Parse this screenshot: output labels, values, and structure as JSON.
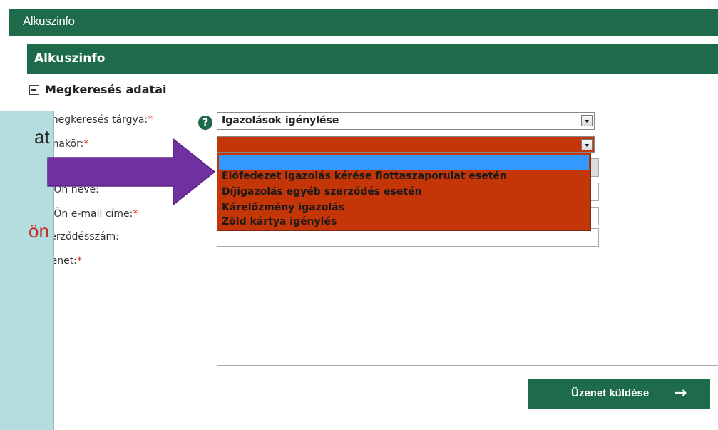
{
  "window": {
    "title": "Alkuszinfo"
  },
  "panel": {
    "title": "Alkuszinfo"
  },
  "section": {
    "title": "Megkeresés adatai"
  },
  "form": {
    "subject_label": "A megkeresés tárgya:",
    "subject_value": "Igazolások igénylése",
    "topic_label": "Témakör:",
    "name_label": "Az Ön neve:",
    "email_label": "Az Ön e-mail címe:",
    "contract_label": "Szerződésszám:",
    "message_label": "Üzenet:",
    "required_mark": "*",
    "help_icon": "?"
  },
  "dropdown": {
    "options": [
      "Előfedezet igazolás kérése flottaszaporulat esetén",
      "Díjigazolás egyéb szerződés esetén",
      "Kárelőzmény igazolás",
      "Zöld kártya igénylés"
    ]
  },
  "actions": {
    "send_label": "Üzenet küldése",
    "send_icon": "→"
  },
  "overlay": {
    "line1": "at",
    "line2": "ön"
  },
  "colors": {
    "brand_green": "#1e6b4b",
    "dropdown_bg": "#c43507",
    "highlight": "#3399ff",
    "overlay_bg": "#b5dde0",
    "arrow": "#7030a0"
  }
}
